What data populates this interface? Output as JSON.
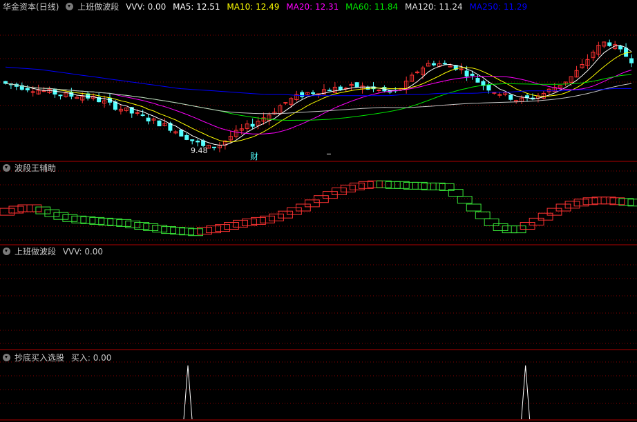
{
  "panel1": {
    "stock": "华金资本",
    "period": "(日线)",
    "indicator": "上班做波段",
    "vvv": "VVV: 0.00",
    "ma5": "MA5: 12.51",
    "ma10": "MA10: 12.49",
    "ma20": "MA20: 12.31",
    "ma60": "MA60: 11.84",
    "ma120": "MA120: 11.24",
    "ma250": "MA250: 11.29",
    "low_label": "9.48",
    "marker": "财"
  },
  "panel2": {
    "title": "波段王辅助"
  },
  "panel3": {
    "title": "上班做波段",
    "vvv": "VVV: 0.00"
  },
  "panel4": {
    "title": "抄底买入选股",
    "buy": "买入: 0.00"
  },
  "colors": {
    "up": "#ff3232",
    "down": "#54ffff",
    "ma5": "#ffffff",
    "ma10": "#ffff00",
    "ma20": "#ff00ff",
    "ma60": "#00e600",
    "ma120": "#c8c8c8",
    "ma250": "#0000ff",
    "grid": "#8b0000",
    "divider": "#b00000"
  },
  "chart_data": [
    {
      "type": "candlestick",
      "title": "上班做波段",
      "close_trend": [
        12.2,
        12.1,
        12.0,
        11.9,
        11.8,
        11.7,
        11.7,
        11.6,
        11.4,
        11.2,
        11.0,
        10.8,
        10.6,
        10.4,
        10.1,
        9.8,
        9.5,
        9.6,
        10.0,
        10.3,
        10.6,
        10.9,
        11.3,
        11.6,
        11.8,
        11.9,
        12.0,
        12.0,
        12.1,
        12.0,
        11.9,
        11.8,
        12.2,
        12.8,
        13.1,
        13.0,
        12.9,
        12.6,
        12.2,
        11.9,
        11.7,
        11.5,
        11.6,
        11.8,
        12.1,
        12.4,
        12.9,
        13.6,
        14.0,
        13.6,
        13.2
      ],
      "ma250_trend": [
        12.9,
        12.85,
        12.8,
        12.7,
        12.6,
        12.5,
        12.4,
        12.3,
        12.2,
        12.1,
        12.0,
        11.95,
        11.9,
        11.85,
        11.8,
        11.75,
        11.75,
        11.7,
        11.7,
        11.7,
        11.7,
        11.7,
        11.7,
        11.75,
        11.75,
        11.8,
        11.8,
        11.8,
        11.85,
        11.85,
        11.9,
        11.9,
        11.9,
        11.95,
        11.95,
        12.0,
        12.0
      ],
      "low_marker": 9.48,
      "last_values": {
        "VVV": 0.0,
        "MA5": 12.51,
        "MA10": 12.49,
        "MA20": 12.31,
        "MA60": 11.84,
        "MA120": 11.24,
        "MA250": 11.29
      }
    },
    {
      "type": "area",
      "title": "波段王辅助",
      "series": [
        {
          "color": "up",
          "values": [
            0.45,
            0.48,
            0.5,
            0.5
          ]
        },
        {
          "color": "down",
          "values": [
            0.5,
            0.47,
            0.43,
            0.39,
            0.36,
            0.34,
            0.33,
            0.32,
            0.31,
            0.3,
            0.29,
            0.27,
            0.25,
            0.23,
            0.21,
            0.19,
            0.18,
            0.17,
            0.16
          ]
        },
        {
          "color": "up",
          "values": [
            0.16,
            0.18,
            0.2,
            0.22,
            0.25,
            0.28,
            0.3,
            0.32,
            0.34,
            0.37,
            0.41,
            0.46,
            0.51,
            0.57,
            0.63,
            0.69,
            0.74,
            0.78,
            0.81,
            0.83,
            0.84
          ]
        },
        {
          "color": "down",
          "values": [
            0.84,
            0.84,
            0.83,
            0.83,
            0.82,
            0.82,
            0.81,
            0.81,
            0.8
          ]
        },
        {
          "color": "down",
          "values": [
            0.8,
            0.72,
            0.62,
            0.51,
            0.4,
            0.3,
            0.23,
            0.2,
            0.2
          ]
        },
        {
          "color": "up",
          "values": [
            0.2,
            0.25,
            0.31,
            0.38,
            0.45,
            0.51,
            0.55,
            0.58,
            0.6,
            0.61,
            0.61,
            0.6
          ]
        },
        {
          "color": "down",
          "values": [
            0.6,
            0.59,
            0.58
          ]
        }
      ]
    },
    {
      "type": "line",
      "title": "上班做波段",
      "series": [
        {
          "name": "VVV",
          "values": [
            0
          ]
        }
      ]
    },
    {
      "type": "line",
      "title": "抄底买入选股",
      "series": [
        {
          "name": "买入",
          "spikes_at": [
            0.295,
            0.825
          ],
          "values": [
            1,
            1
          ]
        }
      ],
      "ylim": [
        0,
        1
      ]
    }
  ]
}
